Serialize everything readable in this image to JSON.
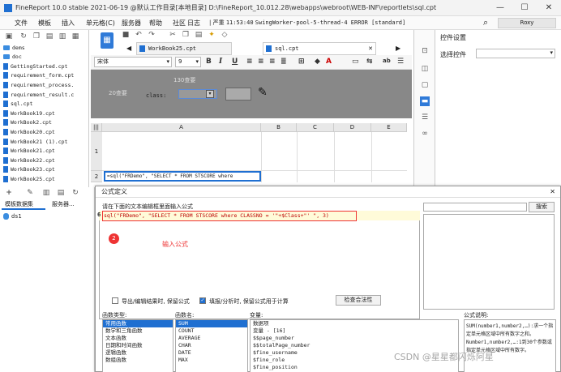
{
  "window": {
    "title": "FineReport 10.0 stable 2021-06-19 @默认工作目录[本地目录]   D:\\FineReport_10.012.28\\webapps\\webroot\\WEB-INF\\reportlets\\sql.cpt",
    "minimize": "—",
    "maximize": "☐",
    "close": "✕"
  },
  "menu": {
    "items": [
      "文件",
      "模板",
      "插入",
      "单元格(C)",
      "服务器",
      "帮助",
      "社区",
      "日志"
    ],
    "status_sep": "|",
    "status_label": "严重",
    "status_time": "11:53:40",
    "status_msg": "SwingWorker-pool-5-thread-4 ERROR [standard]",
    "search_icon_glyph": "⌕",
    "user": "Roxy"
  },
  "left_panel": {
    "tree": [
      {
        "type": "folder",
        "label": "dems"
      },
      {
        "type": "folder",
        "label": "doc"
      },
      {
        "type": "file",
        "label": "GettingStarted.cpt"
      },
      {
        "type": "file",
        "label": "requirement_form.cpt"
      },
      {
        "type": "file",
        "label": "requirement_process."
      },
      {
        "type": "file",
        "label": "requirement_result.c"
      },
      {
        "type": "file",
        "label": "sql.cpt"
      },
      {
        "type": "file",
        "label": "WorkBook19.cpt"
      },
      {
        "type": "file",
        "label": "WorkBook2.cpt"
      },
      {
        "type": "file",
        "label": "WorkBook20.cpt"
      },
      {
        "type": "file",
        "label": "WorkBook21 (1).cpt"
      },
      {
        "type": "file",
        "label": "WorkBook21.cpt"
      },
      {
        "type": "file",
        "label": "WorkBook22.cpt"
      },
      {
        "type": "file",
        "label": "WorkBook23.cpt"
      },
      {
        "type": "file",
        "label": "WorkBook25.cpt"
      }
    ],
    "tabs": [
      "模板数据集",
      "服务器..."
    ],
    "dataset": "ds1"
  },
  "tabs": [
    {
      "label": "WorkBook25.cpt",
      "active": false
    },
    {
      "label": "sql.cpt",
      "active": true
    }
  ],
  "format_bar": {
    "font": "宋体",
    "size": "9",
    "bold": "B",
    "italic": "I",
    "underline": "U"
  },
  "dark_area": {
    "label1": "130查要",
    "label2": "20查要",
    "field_label": "class:",
    "field_value": "",
    "pencil": "✎"
  },
  "grid": {
    "columns": [
      "A",
      "B",
      "C",
      "D",
      "E"
    ],
    "rows": [
      "1",
      "2"
    ],
    "cell_a2": "=sql(\"FRDemo\", \"SELECT * FROM STSCORE where"
  },
  "right_panel": {
    "title": "控件设置",
    "select_label": "选择控件",
    "select_value": ""
  },
  "dialog": {
    "title": "公式定义",
    "close": "✕",
    "prompt": "请在下面的文本编辑框里面输入公式",
    "line_number": "6",
    "formula": "sql(\"FRDemo\", \"SELECT * FROM STSCORE where CLASSNO = '\"+$Class+\"' \", 3)",
    "marker_num": "2",
    "annotation": "输入公式",
    "search_btn": "搜索",
    "chk1": "导出/编辑结果时, 保留公式",
    "chk2": "填报/分析时, 保留公式用于计算",
    "check_btn": "检查合法性",
    "func_type_label": "函数类型:",
    "func_name_label": "函数名:",
    "var_label": "变量:",
    "desc_label": "公式说明:",
    "func_types": [
      "常用函数",
      "数学和三角函数",
      "文本函数",
      "日期和时间函数",
      "逻辑函数",
      "数组函数"
    ],
    "func_names": [
      "SUM",
      "COUNT",
      "AVERAGE",
      "CHAR",
      "DATE",
      "MAX"
    ],
    "variables": [
      "数据项",
      "变量 - [16]",
      "$$page_number",
      "$$totalPage_number",
      "$fine_username",
      "$fine_role",
      "$fine_position"
    ],
    "description": "SUM(number1,number2,…):求一个指定单元格区域中所有数字之和。 Number1,number2,…:1到30个参数或指定单元格区域中所有数字。"
  },
  "watermark": "CSDN @星星都闪烁阿星"
}
